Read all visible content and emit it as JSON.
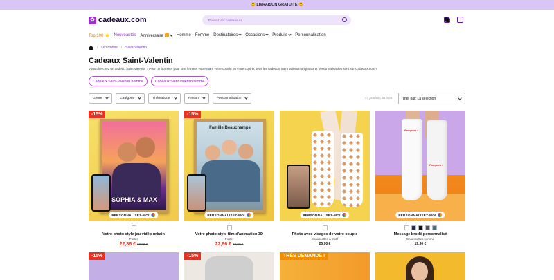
{
  "topbar": {
    "text": "😊 LIVRAISON GRATUITE 😊"
  },
  "header": {
    "logo": "cadeaux.com",
    "search_placeholder": "Trouvez vos cadeaux ici"
  },
  "nav": {
    "items": [
      "Top 100",
      "Nouveautés",
      "Anniversaire",
      "Homme",
      "Femme",
      "Destinataires",
      "Occasions",
      "Produits",
      "Personnalisation"
    ]
  },
  "breadcrumb": {
    "items": [
      "Occasions",
      "Saint-Valentin"
    ]
  },
  "page": {
    "title": "Cadeaux Saint-Valentin",
    "intro": "Vous cherchez un cadeau Saint Valentin ? Pour un homme, pour une femme, votre man, votre copain ou votre copine, tous les cadeaux Saint Valentin originaux et personnalisables sont sur Cadeaux.com !"
  },
  "pills": [
    "Cadeaux Saint-Valentin homme",
    "Cadeaux Saint-Valentin femme"
  ],
  "filters": [
    "Genre",
    "Catégorie",
    "Thématique",
    "Finition",
    "Personnalisation"
  ],
  "results": {
    "count": "47 produits au total",
    "sort": "Trier par: La sélection"
  },
  "personalize_label": "PERSONNALISEZ-MOI",
  "products": [
    {
      "badge": "-15%",
      "name": "Votre photo style jeu vidéo urbain",
      "sub": "Poster",
      "price": "22,86 €",
      "old": "26,90 €",
      "frame_text": "SOPHIA & MAX"
    },
    {
      "badge": "-15%",
      "name": "Votre photo style film d'animation 3D",
      "sub": "Poster",
      "price": "22,86 €",
      "old": "26,90 €",
      "frame_text": "Famille Beauchamps"
    },
    {
      "badge": "",
      "name": "Photo avec visages de votre couple",
      "sub": "Chaussettes à motif",
      "price": "25,90 €",
      "old": ""
    },
    {
      "badge": "",
      "name": "Message brodé personnalisé",
      "sub": "Chaussettes homme",
      "price": "19,90 €",
      "old": "",
      "sock_text": "Pompom !"
    }
  ],
  "row2": [
    {
      "badge": "-15%"
    },
    {
      "badge": "-15%"
    },
    {
      "badge": "TRÈS DEMANDÉ !"
    },
    {
      "badge": ""
    }
  ],
  "colors": {
    "accent": "#9d2fd6",
    "sale": "#e8321f",
    "topbar": "#d9c6f6"
  }
}
